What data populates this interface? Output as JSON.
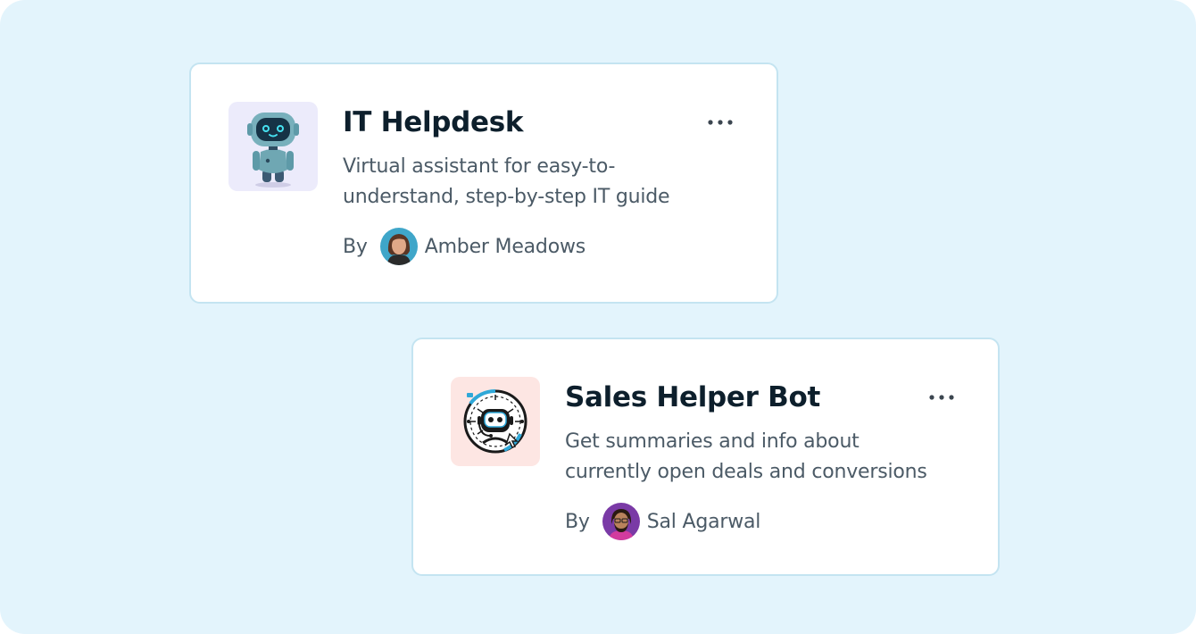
{
  "colors": {
    "background": "#e3f4fc",
    "card_border": "#c4e4f1",
    "title": "#0d1f2c",
    "body_text": "#4b5a66",
    "tile_it": "#ecebfb",
    "tile_sales": "#fde6e3"
  },
  "cards": [
    {
      "icon": "robot-mascot-icon",
      "title": "IT Helpdesk",
      "description": "Virtual assistant for easy-to-understand, step-by-step IT guide",
      "by_label": "By",
      "author": "Amber Meadows",
      "menu_icon": "more-horizontal-icon"
    },
    {
      "icon": "robot-circuit-badge-icon",
      "title": "Sales Helper Bot",
      "description": "Get summaries and info about currently open deals and conversions",
      "by_label": "By",
      "author": "Sal Agarwal",
      "menu_icon": "more-horizontal-icon"
    }
  ]
}
